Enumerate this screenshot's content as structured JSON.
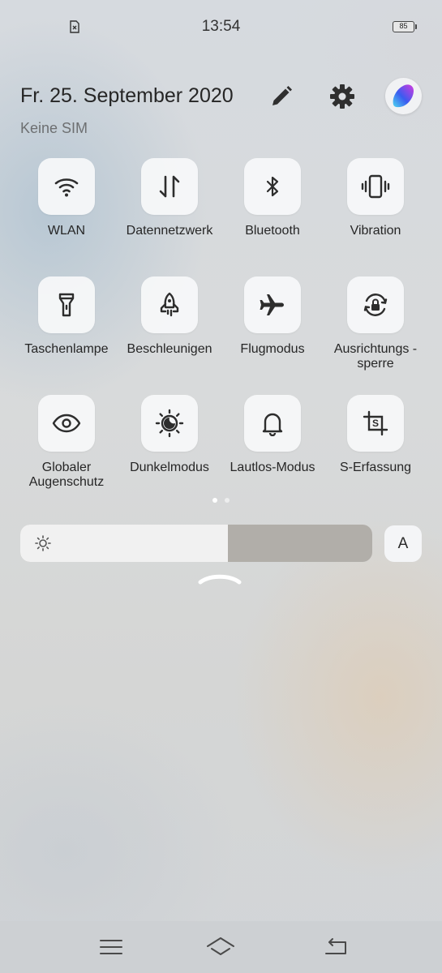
{
  "status_bar": {
    "time": "13:54",
    "battery_level": "85",
    "sim_icon": "no-sim-icon"
  },
  "header": {
    "date": "Fr. 25. September 2020",
    "sim_status": "Keine SIM",
    "edit_icon": "pencil-icon",
    "settings_icon": "gear-icon",
    "avatar_icon": "jovi-assistant-icon"
  },
  "tiles": [
    {
      "label": "WLAN",
      "icon": "wifi-icon"
    },
    {
      "label": "Datennetzwerk",
      "icon": "mobile-data-icon"
    },
    {
      "label": "Bluetooth",
      "icon": "bluetooth-icon"
    },
    {
      "label": "Vibration",
      "icon": "vibration-icon"
    },
    {
      "label": "Taschenlampe",
      "icon": "flashlight-icon"
    },
    {
      "label": "Beschleunigen",
      "icon": "rocket-icon"
    },
    {
      "label": "Flugmodus",
      "icon": "airplane-icon"
    },
    {
      "label": "Ausrichtungs -\nsperre",
      "icon": "rotation-lock-icon"
    },
    {
      "label": "Globaler\nAugenschutz",
      "icon": "eye-icon"
    },
    {
      "label": "Dunkelmodus",
      "icon": "dark-mode-icon"
    },
    {
      "label": "Lautlos-Modus",
      "icon": "bell-icon"
    },
    {
      "label": "S-Erfassung",
      "icon": "screenshot-icon"
    }
  ],
  "pager": {
    "current_page": 1,
    "total_pages": 2
  },
  "brightness": {
    "level": 0.59,
    "auto_label": "A",
    "icon": "sun-icon"
  },
  "collapse_icon": "chevron-up-icon",
  "nav_bar": {
    "menu_icon": "menu-icon",
    "home_icon": "home-icon",
    "back_icon": "back-icon"
  },
  "colors": {
    "tile_bg": "#f7f8fa",
    "slider_track": "#b1aea9",
    "slider_fill": "#f4f4f4",
    "text": "#262626",
    "dot_active": "#ffffff"
  }
}
